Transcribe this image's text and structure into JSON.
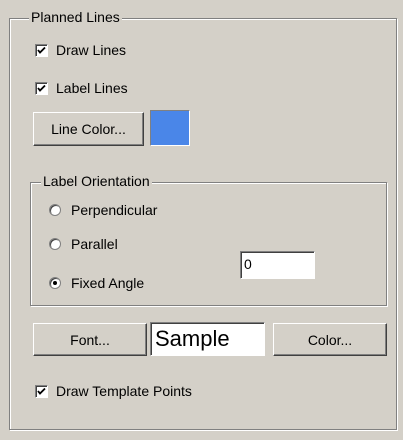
{
  "planned_lines": {
    "title": "Planned Lines",
    "draw_lines": {
      "label": "Draw Lines",
      "checked": true
    },
    "label_lines": {
      "label": "Label Lines",
      "checked": true
    },
    "line_color_button": "Line Color...",
    "line_color": "#4a86e8"
  },
  "label_orientation": {
    "title": "Label Orientation",
    "options": [
      {
        "label": "Perpendicular",
        "selected": false
      },
      {
        "label": "Parallel",
        "selected": false
      },
      {
        "label": "Fixed Angle",
        "selected": true
      }
    ],
    "angle_value": "0"
  },
  "font": {
    "font_button": "Font...",
    "sample_text": "Sample",
    "color_button": "Color..."
  },
  "draw_template_points": {
    "label": "Draw Template Points",
    "checked": true
  }
}
